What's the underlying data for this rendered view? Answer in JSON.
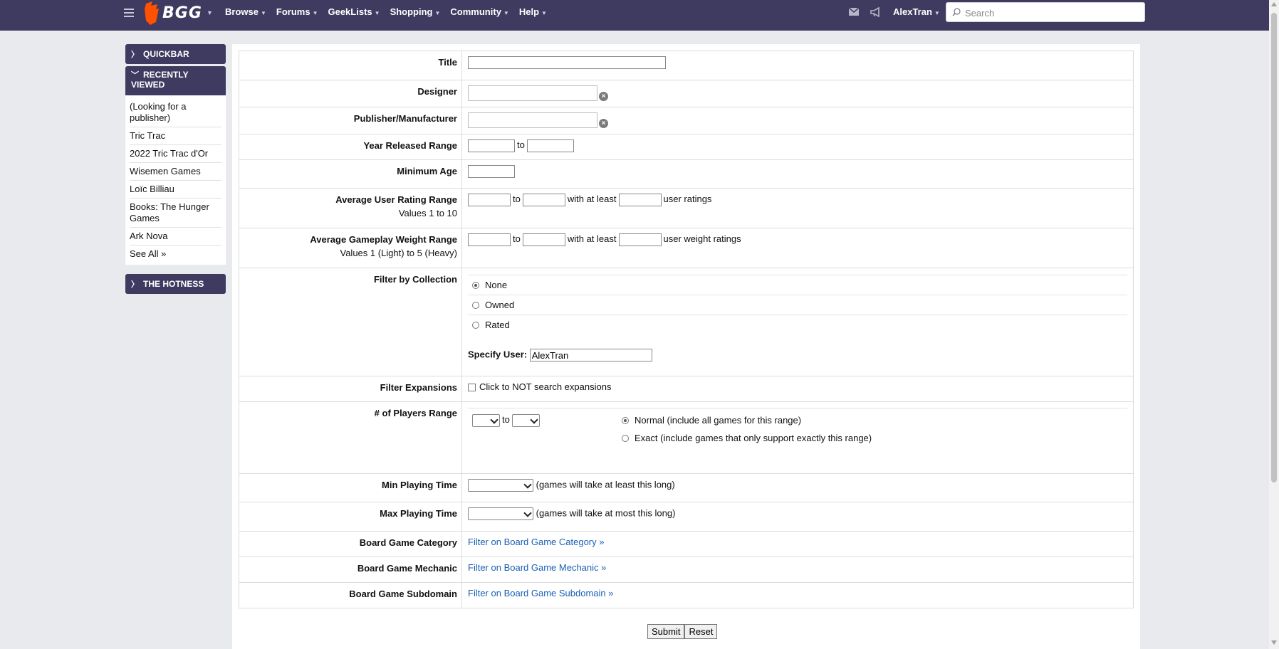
{
  "nav": {
    "logo_text": "BGG",
    "items": [
      {
        "label": "Browse"
      },
      {
        "label": "Forums"
      },
      {
        "label": "GeekLists"
      },
      {
        "label": "Shopping"
      },
      {
        "label": "Community"
      },
      {
        "label": "Help"
      }
    ],
    "user": "AlexTran",
    "search_placeholder": "Search"
  },
  "sidebar": {
    "quickbar": "QUICKBAR",
    "recently_viewed": "RECENTLY VIEWED",
    "recent_items": [
      "(Looking for a publisher)",
      "Tric Trac",
      "2022 Tric Trac d'Or",
      "Wisemen Games",
      "Loïc Billiau",
      "Books: The Hunger Games",
      "Ark Nova"
    ],
    "see_all": "See All »",
    "hotness": "THE HOTNESS"
  },
  "form": {
    "title_label": "Title",
    "designer_label": "Designer",
    "publisher_label": "Publisher/Manufacturer",
    "year_label": "Year Released Range",
    "to": "to",
    "min_age_label": "Minimum Age",
    "rating_label": "Average User Rating Range",
    "rating_sub": "Values 1 to 10",
    "with_at_least": "with at least",
    "user_ratings": "user ratings",
    "weight_label": "Average Gameplay Weight Range",
    "weight_sub": "Values 1 (Light) to 5 (Heavy)",
    "user_weight_ratings": "user weight ratings",
    "collection_label": "Filter by Collection",
    "collection_options": [
      "None",
      "Owned",
      "Rated"
    ],
    "collection_selected": "None",
    "specify_user_label": "Specify User:",
    "specify_user_value": "AlexTran",
    "expansions_label": "Filter Expansions",
    "expansions_checkbox": "Click to NOT search expansions",
    "players_label": "# of Players Range",
    "players_normal": "Normal (include all games for this range)",
    "players_exact": "Exact (include games that only support exactly this range)",
    "players_mode_selected": "Normal",
    "min_time_label": "Min Playing Time",
    "min_time_hint": "(games will take at least this long)",
    "max_time_label": "Max Playing Time",
    "max_time_hint": "(games will take at most this long)",
    "category_label": "Board Game Category",
    "category_link": "Filter on Board Game Category »",
    "mechanic_label": "Board Game Mechanic",
    "mechanic_link": "Filter on Board Game Mechanic »",
    "subdomain_label": "Board Game Subdomain",
    "subdomain_link": "Filter on Board Game Subdomain »",
    "submit": "Submit",
    "reset": "Reset"
  },
  "colors": {
    "nav_bg": "#3f3a60",
    "link": "#1a5fb4",
    "logo_orange": "#ff5100"
  }
}
